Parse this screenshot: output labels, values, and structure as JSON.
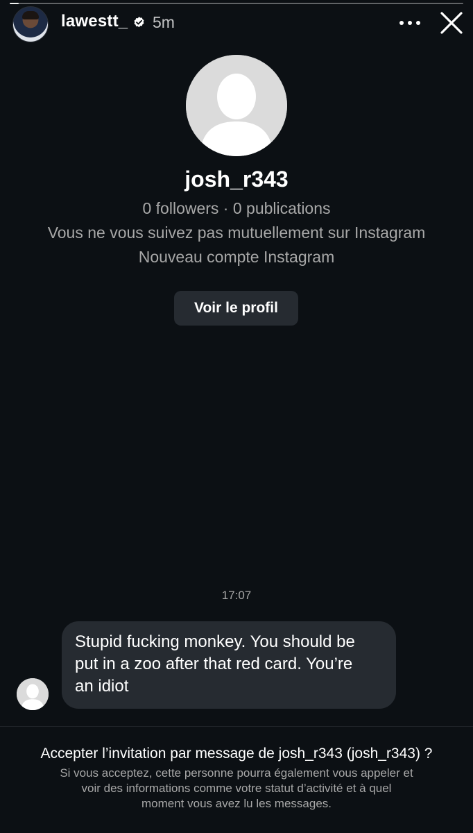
{
  "story_header": {
    "username": "lawestt_",
    "time_ago": "5m",
    "progress": 0.02
  },
  "profile": {
    "username": "josh_r343",
    "stats": "0 followers · 0 publications",
    "mutual_text": "Vous ne vous suivez pas mutuellement sur Instagram",
    "new_account_text": "Nouveau compte Instagram",
    "view_profile_label": "Voir le profil"
  },
  "conversation": {
    "timestamp": "17:07",
    "message_line_1": "Stupid fucking monkey. You should be",
    "message_line_2": "put in a zoo after that red card. You’re",
    "message_line_3": "an idiot"
  },
  "invitation": {
    "title": "Accepter l’invitation par message de josh_r343 (josh_r343) ?",
    "desc_line_1": "Si vous acceptez, cette personne pourra également vous appeler et",
    "desc_line_2": "voir des informations comme votre statut d’activité et à quel",
    "desc_line_3": "moment vous avez lu les messages."
  },
  "colors": {
    "background": "#0c1014",
    "bubble": "#262b31",
    "secondary_text": "#a8a8a8"
  },
  "icons": [
    "verified-badge-icon",
    "more-icon",
    "close-icon",
    "default-avatar-icon"
  ]
}
